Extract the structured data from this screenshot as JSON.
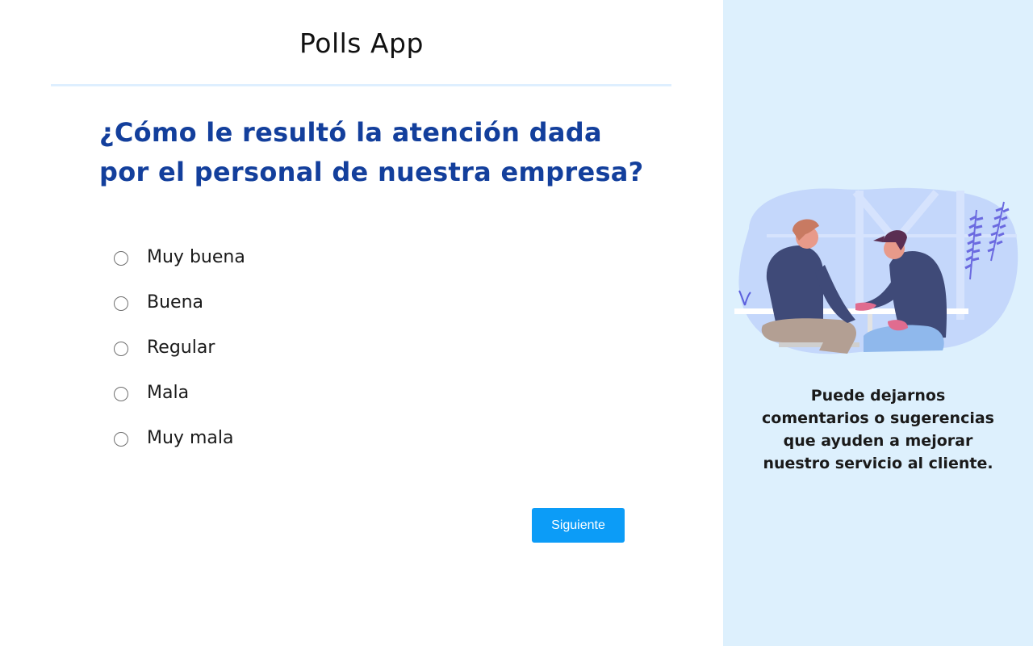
{
  "app": {
    "title": "Polls App"
  },
  "question": {
    "text": "¿Cómo le resultó la atención dada por el personal de nuestra empresa?"
  },
  "options": [
    {
      "label": "Muy buena",
      "selected": false
    },
    {
      "label": "Buena",
      "selected": false
    },
    {
      "label": "Regular",
      "selected": false
    },
    {
      "label": "Mala",
      "selected": false
    },
    {
      "label": "Muy mala",
      "selected": false
    }
  ],
  "actions": {
    "next_label": "Siguiente"
  },
  "sidebar": {
    "illustration": "two-people-talking-illustration",
    "message": "Puede dejarnos comentarios o sugerencias que ayuden a mejorar nuestro servicio al cliente."
  },
  "colors": {
    "question": "#133f9c",
    "button": "#0c9cf7",
    "sidebar_bg": "#ddf0fd",
    "divider": "#deefff"
  }
}
